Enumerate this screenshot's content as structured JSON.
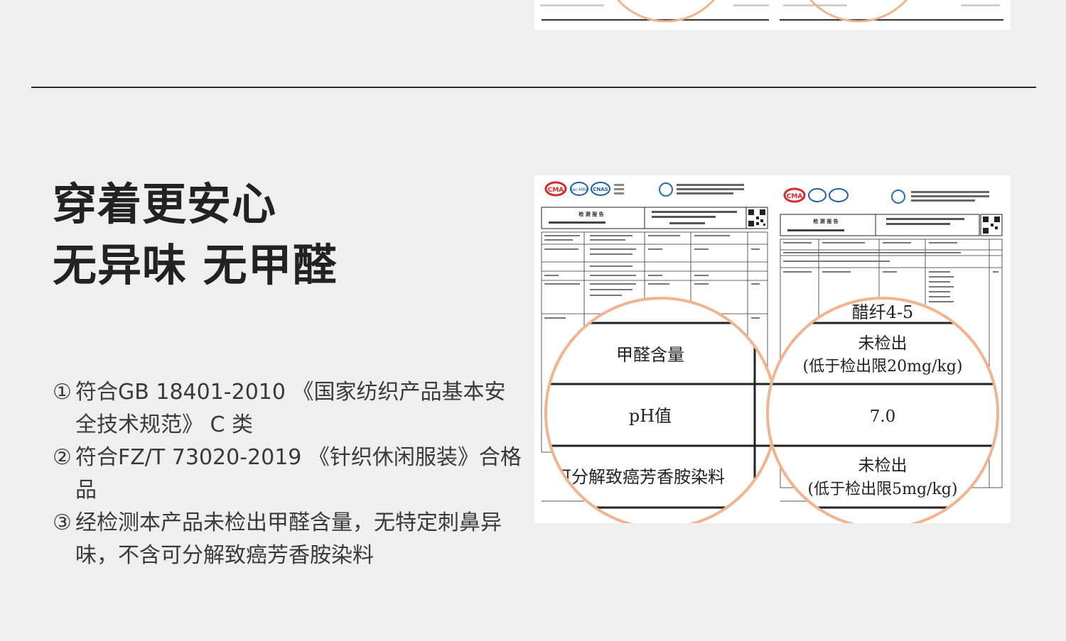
{
  "headline": {
    "line1": "穿着更安心",
    "line2": "无异味 无甲醛"
  },
  "points": [
    {
      "num": "①",
      "text": "符合GB 18401-2010 《国家纺织产品基本安全技术规范》 C 类"
    },
    {
      "num": "②",
      "text": "符合FZ/T 73020-2019 《针织休闲服装》合格品"
    },
    {
      "num": "③",
      "text": "经检测本产品未检出甲醛含量，无特定刺鼻异味，不含可分解致癌芳香胺染料"
    }
  ],
  "certificate": {
    "logos": [
      "CMA",
      "ilac-MRA",
      "CNAS"
    ],
    "report_title": "检 测 报 告",
    "zoom_left": {
      "row1": "甲醛含量",
      "row2": "pH值",
      "row3": "可分解致癌芳香胺染料"
    },
    "zoom_right": {
      "header": "醋纤4-5",
      "row1_line1": "未检出",
      "row1_line2": "(低于检出限20mg/kg)",
      "row2": "7.0",
      "row3_line1": "未检出",
      "row3_line2": "(低于检出限5mg/kg)"
    }
  },
  "colors": {
    "background": "#efefef",
    "circle_border": "#f2b48e",
    "divider": "#2a2a2a"
  }
}
